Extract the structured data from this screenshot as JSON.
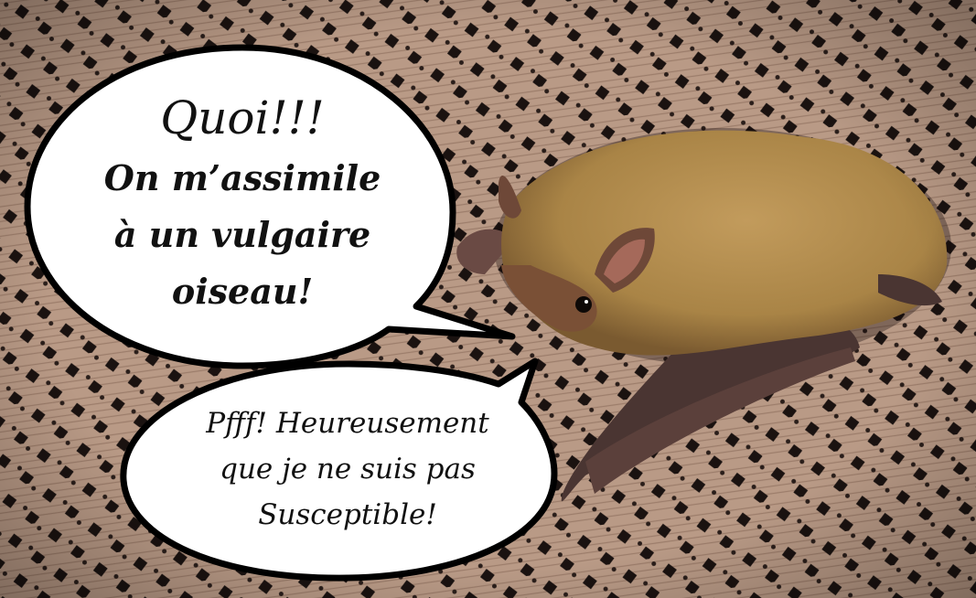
{
  "scene": {
    "subject": "bat-on-patterned-fabric",
    "colors": {
      "fabric_light": "#b99a86",
      "fabric_dark": "#1a1210",
      "fur": "#b08a4d",
      "fur_dark": "#7a5a30",
      "wing_membrane": "#4a3532",
      "bubble_fill": "#ffffff",
      "bubble_stroke": "#000000"
    }
  },
  "bubble_top": {
    "line1": "Quoi!!!",
    "line2": "On m’assimile",
    "line3": "à un vulgaire",
    "line4": "oiseau!"
  },
  "bubble_bottom": {
    "line1": "Pfff! Heureusement",
    "line2": "que je ne suis pas",
    "line3": "Susceptible!"
  }
}
